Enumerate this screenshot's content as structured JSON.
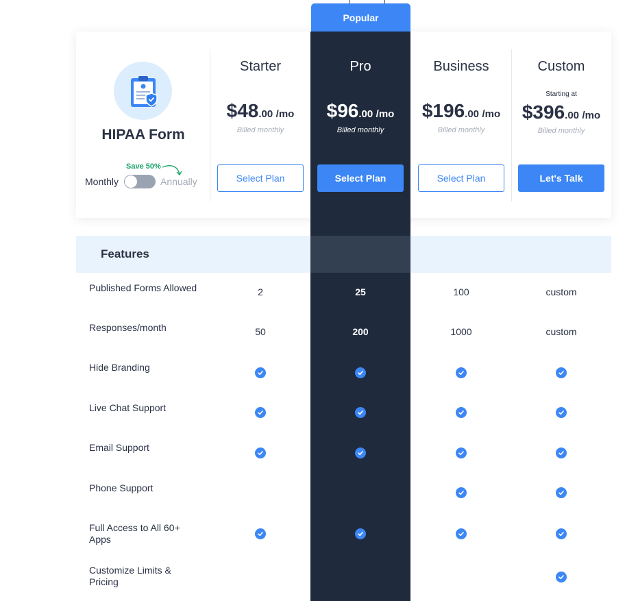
{
  "popular_badge": "Popular",
  "brand": {
    "title": "HIPAA Form",
    "icon": "hipaa-form-document-icon"
  },
  "billing": {
    "save_label": "Save 50%",
    "monthly_label": "Monthly",
    "annually_label": "Annually",
    "annual_selected": false
  },
  "plans": [
    {
      "name": "Starter",
      "starting_at": "",
      "price_main": "$48",
      "price_cents": ".00",
      "price_period": "/mo",
      "billed": "Billed monthly",
      "button": "Select Plan"
    },
    {
      "name": "Pro",
      "starting_at": "",
      "price_main": "$96",
      "price_cents": ".00",
      "price_period": "/mo",
      "billed": "Billed monthly",
      "button": "Select Plan"
    },
    {
      "name": "Business",
      "starting_at": "",
      "price_main": "$196",
      "price_cents": ".00",
      "price_period": "/mo",
      "billed": "Billed monthly",
      "button": "Select Plan"
    },
    {
      "name": "Custom",
      "starting_at": "Starting at",
      "price_main": "$396",
      "price_cents": ".00",
      "price_period": "/mo",
      "billed": "Billed monthly",
      "button": "Let's Talk"
    }
  ],
  "features_title": "Features",
  "features": [
    {
      "label": "Published Forms Allowed",
      "values": [
        "2",
        "25",
        "100",
        "custom"
      ]
    },
    {
      "label": "Responses/month",
      "values": [
        "50",
        "200",
        "1000",
        "custom"
      ]
    },
    {
      "label": "Hide Branding",
      "values": [
        true,
        true,
        true,
        true
      ]
    },
    {
      "label": "Live Chat Support",
      "values": [
        true,
        true,
        true,
        true
      ]
    },
    {
      "label": "Email Support",
      "values": [
        true,
        true,
        true,
        true
      ]
    },
    {
      "label": "Phone Support",
      "values": [
        false,
        false,
        true,
        true
      ]
    },
    {
      "label": "Full Access to All 60+ Apps",
      "values": [
        true,
        true,
        true,
        true
      ]
    },
    {
      "label": "Customize Limits & Pricing",
      "values": [
        false,
        false,
        false,
        true
      ]
    }
  ],
  "colors": {
    "accent": "#3c87f5",
    "pro_dark": "#1f2a3c",
    "features_band": "#e9f3fd",
    "save_green": "#1aa56a"
  }
}
